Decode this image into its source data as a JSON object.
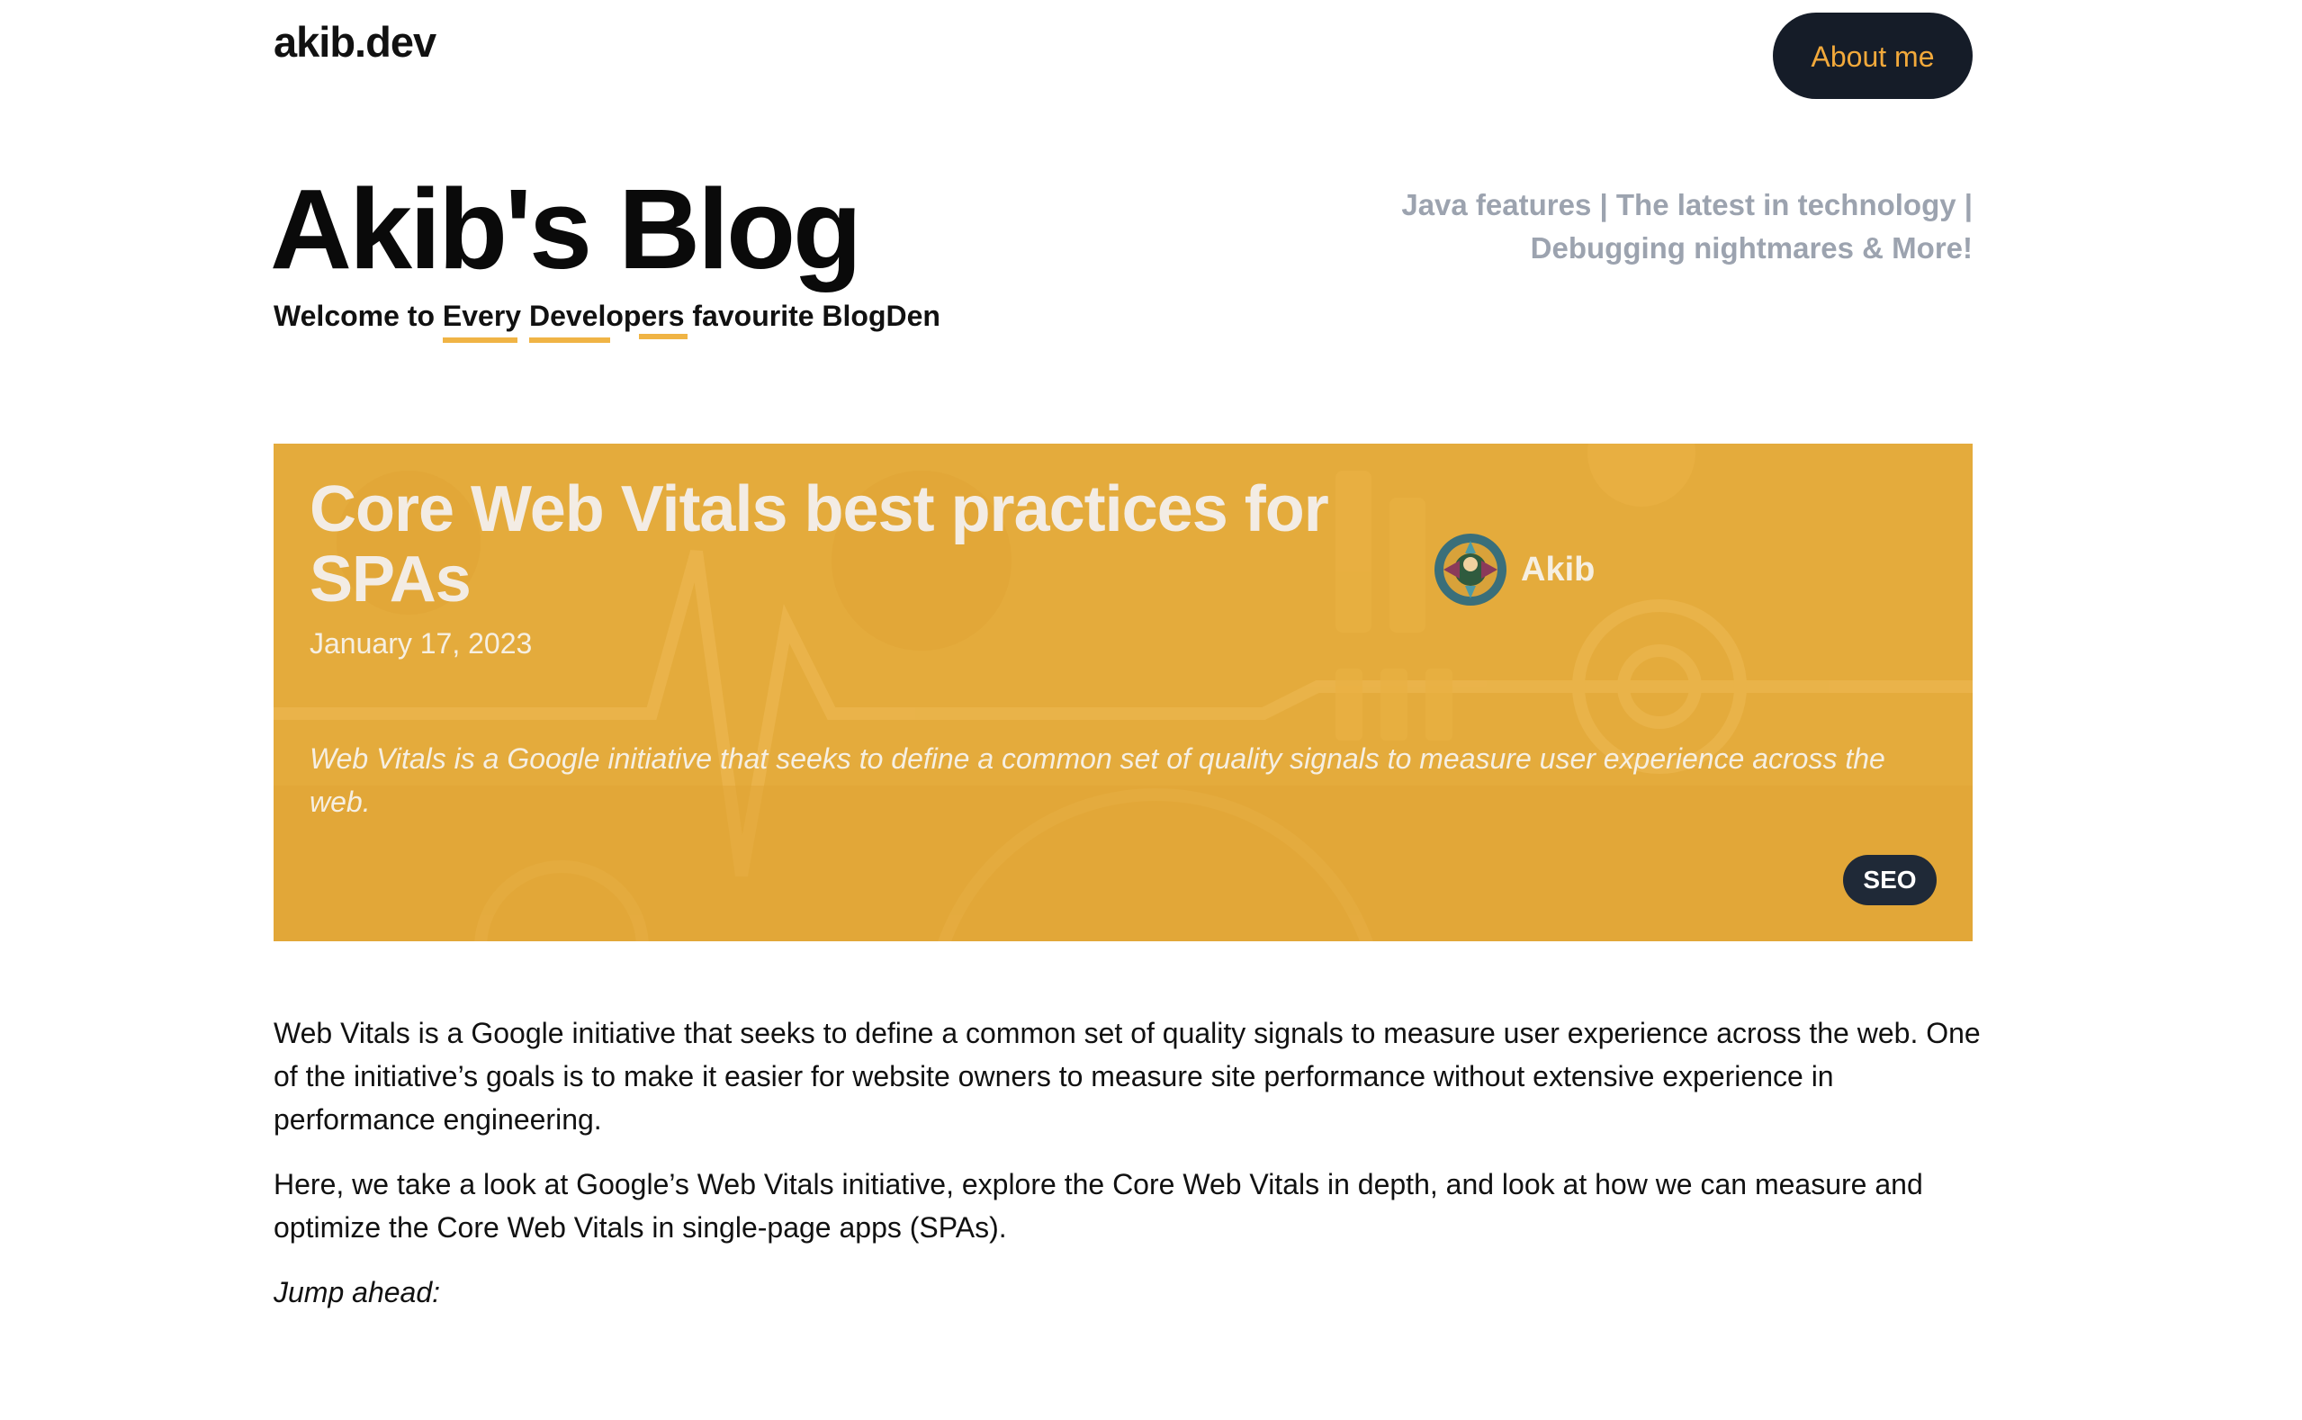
{
  "header": {
    "logo": "akib.dev",
    "about_label": "About me"
  },
  "hero": {
    "title": "Akib's Blog",
    "welcome_prefix": "Welcome to ",
    "word_every": "Every",
    "word_developers": "Developers",
    "welcome_suffix": " favourite BlogDen",
    "tagline_line1": "Java features | The latest in technology |",
    "tagline_line2": "Debugging nightmares & More!"
  },
  "featured": {
    "title": "Core Web Vitals best practices for SPAs",
    "date": "January 17, 2023",
    "author": "Akib",
    "excerpt": "Web Vitals is a Google initiative that seeks to define a common set of quality signals to measure user experience across the web.",
    "tag": "SEO",
    "bg_color": "#e4ab3c"
  },
  "article": {
    "paragraphs": [
      "Web Vitals is a Google initiative that seeks to define a common set of quality signals to measure user experience across the web. One of the initiative’s goals is to make it easier for website owners to measure site performance without extensive experience in performance engineering.",
      "Here, we take a look at Google’s Web Vitals initiative, explore the Core Web Vitals in depth, and look at how we can measure and optimize the Core Web Vitals in single-page apps (SPAs)."
    ],
    "jump_ahead": "Jump ahead:"
  },
  "colors": {
    "accent": "#f0b445",
    "button_bg": "#151c28",
    "button_text": "#f2a93b",
    "tagline": "#9ca3af",
    "badge_bg": "#1f2937"
  }
}
